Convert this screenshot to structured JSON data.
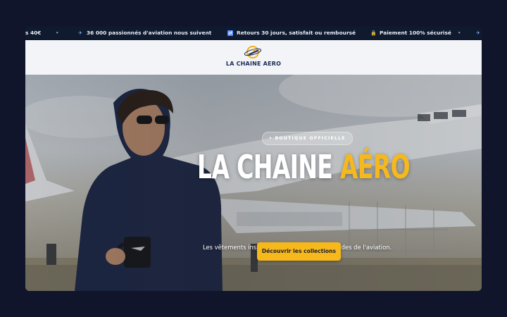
{
  "announcement_bar": {
    "items": [
      {
        "icon": "shipping-truck-icon",
        "text": "s 40€"
      },
      {
        "icon": "airplane-icon",
        "text": "36 000 passionnés d'aviation nous suivent"
      },
      {
        "icon": "return-box-icon",
        "text": "Retours 30 jours, satisfait ou remboursé"
      },
      {
        "icon": "padlock-icon",
        "text": "Paiement 100% sécurisé"
      },
      {
        "icon": "airplane-icon",
        "text": ""
      }
    ]
  },
  "header": {
    "brand": "LA CHAINE AERO",
    "logo_icon": "globe-plane-logo-icon"
  },
  "hero": {
    "badge": "• BOUTIQUE OFFICIELLE",
    "title_main": "LA CHAINE ",
    "title_accent": "AÉRO",
    "subtitle": "Les vêtements inspirés des plus grandes légendes de l'aviation.",
    "cta_label": "Découvrir les collections",
    "accent_color": "#f5b81e",
    "cta_color": "#f6b81a"
  }
}
